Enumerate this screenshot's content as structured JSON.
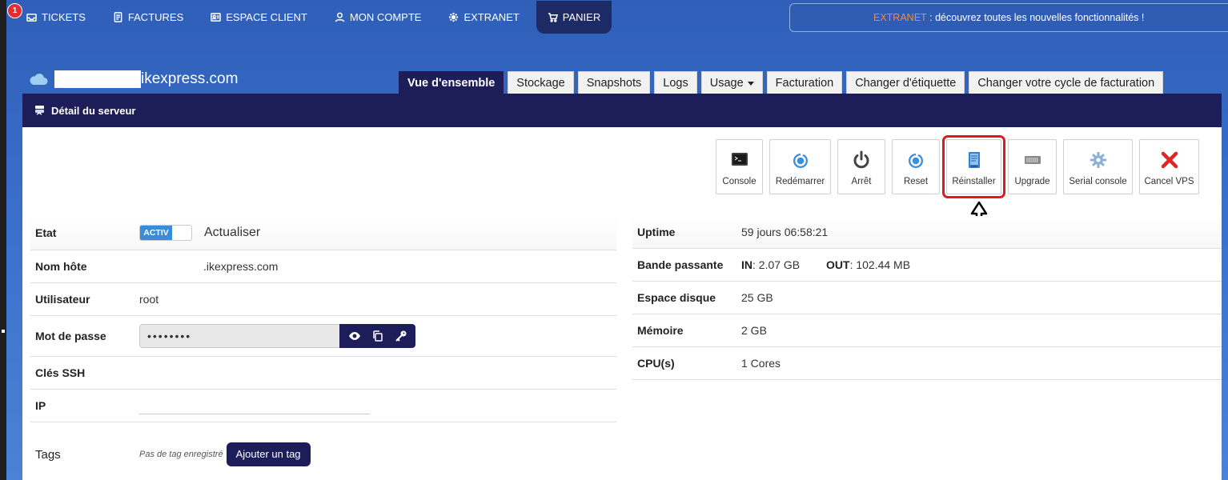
{
  "nav": {
    "badge": "1",
    "items": [
      {
        "label": "TICKETS",
        "icon": "inbox-icon"
      },
      {
        "label": "FACTURES",
        "icon": "document-icon"
      },
      {
        "label": "ESPACE CLIENT",
        "icon": "id-card-icon"
      },
      {
        "label": "MON COMPTE",
        "icon": "user-icon"
      },
      {
        "label": "EXTRANET",
        "icon": "gear-icon"
      },
      {
        "label": "PANIER",
        "icon": "cart-icon"
      }
    ]
  },
  "announcement": {
    "highlight": "EXTRANET",
    "text": " : découvrez toutes les nouvelles fonctionnalités !"
  },
  "domain": "ikexpress.com",
  "tabs": [
    "Vue d'ensemble",
    "Stockage",
    "Snapshots",
    "Logs",
    "Usage",
    "Facturation",
    "Changer d'étiquette",
    "Changer votre cycle de facturation"
  ],
  "panel": {
    "title": "Détail du serveur"
  },
  "actions": [
    {
      "label": "Console",
      "icon": "terminal-icon"
    },
    {
      "label": "Redémarrer",
      "icon": "restart-icon"
    },
    {
      "label": "Arrêt",
      "icon": "power-icon"
    },
    {
      "label": "Reset",
      "icon": "reset-icon"
    },
    {
      "label": "Réinstaller",
      "icon": "reinstall-icon"
    },
    {
      "label": "Upgrade",
      "icon": "upgrade-icon"
    },
    {
      "label": "Serial console",
      "icon": "serial-gear-icon"
    },
    {
      "label": "Cancel VPS",
      "icon": "cancel-x-icon"
    }
  ],
  "details_left": {
    "etat_label": "Etat",
    "etat_toggle": "ACTIV",
    "refresh": "Actualiser",
    "hostname_label": "Nom hôte",
    "hostname_value": ".ikexpress.com",
    "user_label": "Utilisateur",
    "user_value": "root",
    "password_label": "Mot de passe",
    "password_value": "••••••••",
    "ssh_label": "Clés SSH",
    "ip_label": "IP",
    "tags_label": "Tags",
    "no_tag": "Pas de tag enregistré",
    "add_tag": "Ajouter un tag"
  },
  "details_right": {
    "uptime_label": "Uptime",
    "uptime_value": "59 jours 06:58:21",
    "bandwidth_label": "Bande passante",
    "in_label": "IN",
    "in_value": ": 2.07 GB",
    "out_label": "OUT",
    "out_value": ": 102.44 MB",
    "disk_label": "Espace disque",
    "disk_value": "25 GB",
    "memory_label": "Mémoire",
    "memory_value": "2 GB",
    "cpu_label": "CPU(s)",
    "cpu_value": "1 Cores"
  }
}
